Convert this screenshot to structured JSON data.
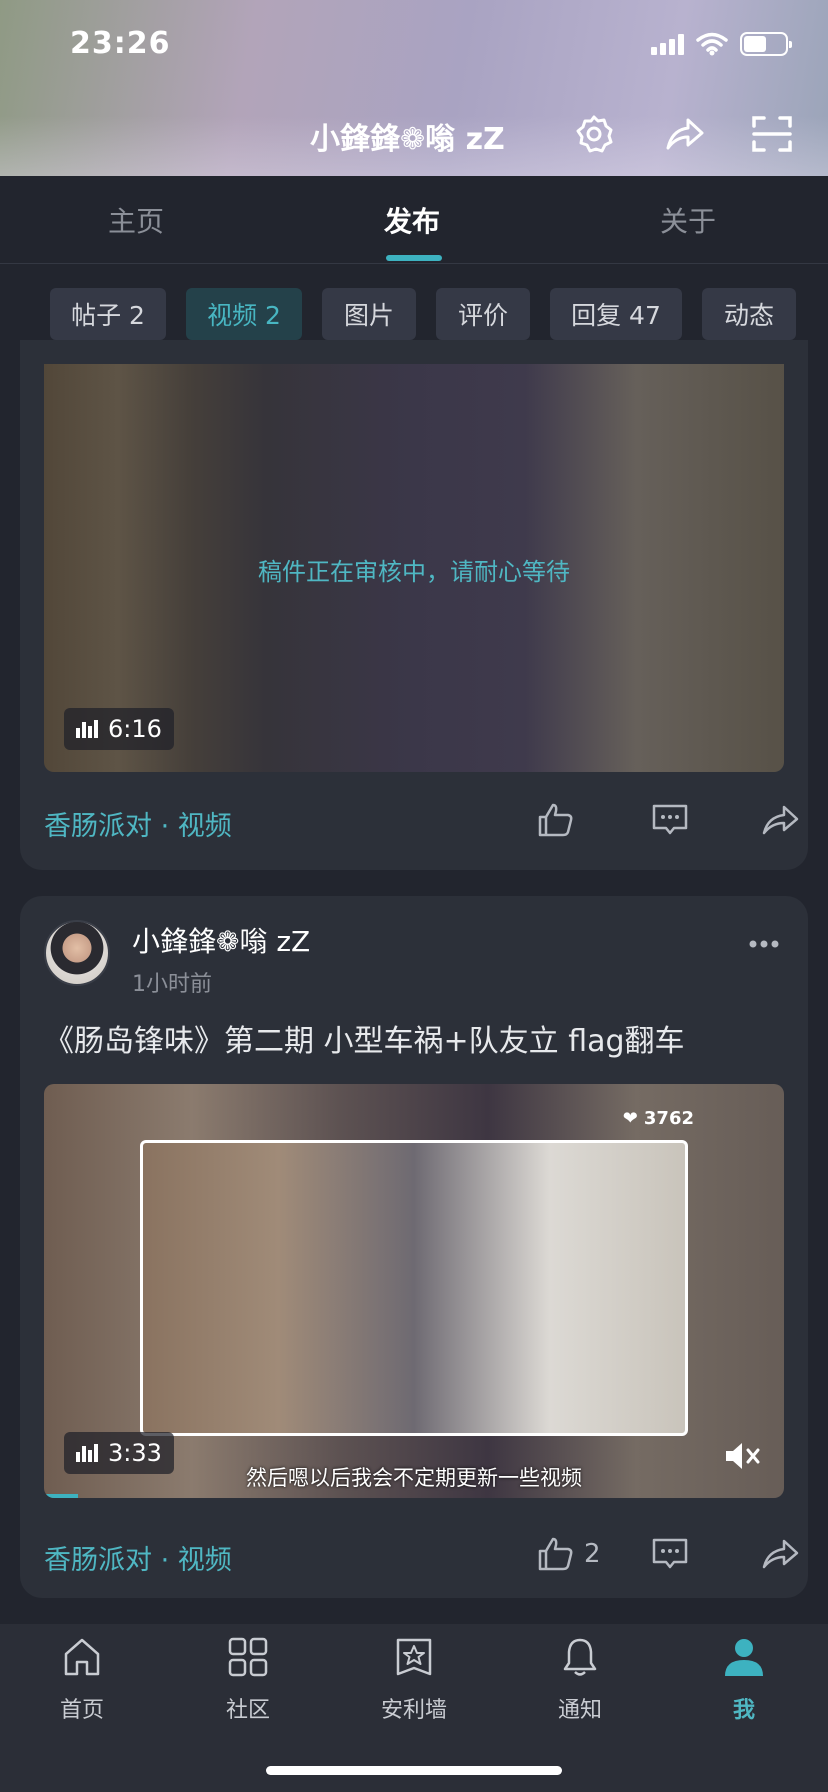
{
  "status_bar": {
    "time": "23:26"
  },
  "header": {
    "title": "小鋒鋒❁嗡 zZ"
  },
  "tabs": [
    {
      "label": "主页",
      "active": false
    },
    {
      "label": "发布",
      "active": true
    },
    {
      "label": "关于",
      "active": false
    }
  ],
  "filters": [
    {
      "label": "帖子 2",
      "active": false
    },
    {
      "label": "视频 2",
      "active": true
    },
    {
      "label": "图片",
      "active": false
    },
    {
      "label": "评价",
      "active": false
    },
    {
      "label": "回复 47",
      "active": false
    },
    {
      "label": "动态",
      "active": false
    }
  ],
  "post1": {
    "review_notice": "稿件正在审核中，请耐心等待",
    "duration": "6:16",
    "category": "香肠派对 · 视频"
  },
  "post2": {
    "author": "小鋒鋒❁嗡 zZ",
    "time": "1小时前",
    "title": "《肠岛锋味》第二期 小型车祸+队友立 flag翻车",
    "video_likes": "3762",
    "duration": "3:33",
    "subtitle": "然后嗯以后我会不定期更新一些视频",
    "category": "香肠派对 · 视频",
    "like_count": "2"
  },
  "bottom_nav": [
    {
      "label": "首页",
      "icon": "home-icon",
      "active": false
    },
    {
      "label": "社区",
      "icon": "grid-icon",
      "active": false
    },
    {
      "label": "安利墙",
      "icon": "star-badge-icon",
      "active": false
    },
    {
      "label": "通知",
      "icon": "bell-icon",
      "active": false
    },
    {
      "label": "我",
      "icon": "person-icon",
      "active": true
    }
  ],
  "colors": {
    "accent": "#3db2c0",
    "background": "#22252e",
    "card": "#2c3039"
  }
}
